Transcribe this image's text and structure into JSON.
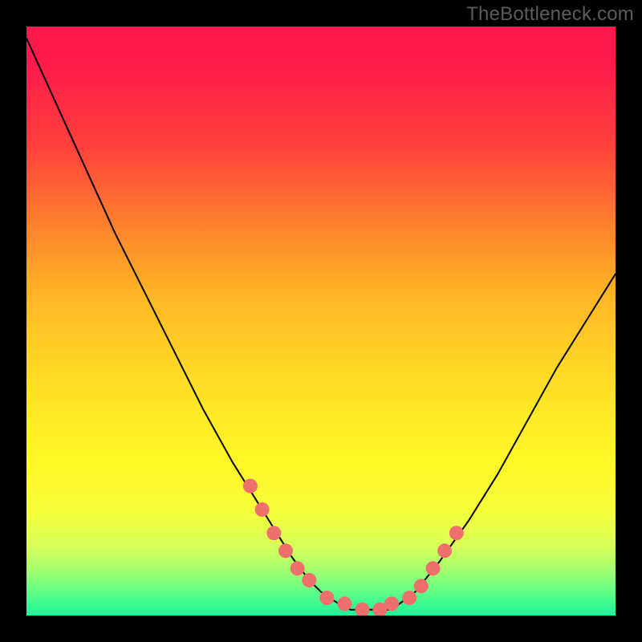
{
  "watermark": "TheBottleneck.com",
  "chart_data": {
    "type": "line",
    "title": "",
    "xlabel": "",
    "ylabel": "",
    "xlim": [
      0,
      100
    ],
    "ylim": [
      0,
      100
    ],
    "grid": false,
    "legend": false,
    "series": [
      {
        "name": "curve",
        "x": [
          0,
          5,
          10,
          15,
          20,
          25,
          30,
          35,
          40,
          45,
          48,
          50,
          53,
          55,
          58,
          62,
          66,
          70,
          75,
          80,
          85,
          90,
          95,
          100
        ],
        "y": [
          98,
          87,
          76,
          65,
          55,
          45,
          35,
          26,
          18,
          10,
          6,
          4,
          2,
          1,
          1,
          1,
          4,
          9,
          16,
          24,
          33,
          42,
          50,
          58
        ]
      },
      {
        "name": "markers",
        "x": [
          38,
          40,
          42,
          44,
          46,
          48,
          51,
          54,
          57,
          60,
          62,
          65,
          67,
          69,
          71,
          73
        ],
        "y": [
          22,
          18,
          14,
          11,
          8,
          6,
          3,
          2,
          1,
          1,
          2,
          3,
          5,
          8,
          11,
          14
        ]
      }
    ],
    "gradient_stops": [
      {
        "pos": 0.0,
        "color": "#ff1a4b"
      },
      {
        "pos": 0.06,
        "color": "#ff1a4b"
      },
      {
        "pos": 0.2,
        "color": "#ff3f3d"
      },
      {
        "pos": 0.33,
        "color": "#ff7e2e"
      },
      {
        "pos": 0.45,
        "color": "#ffb326"
      },
      {
        "pos": 0.56,
        "color": "#ffd226"
      },
      {
        "pos": 0.65,
        "color": "#ffe826"
      },
      {
        "pos": 0.74,
        "color": "#fff726"
      },
      {
        "pos": 0.82,
        "color": "#f7ff3a"
      },
      {
        "pos": 0.88,
        "color": "#d9ff57"
      },
      {
        "pos": 0.92,
        "color": "#a8ff6e"
      },
      {
        "pos": 0.96,
        "color": "#62ff86"
      },
      {
        "pos": 1.0,
        "color": "#17f59a"
      }
    ],
    "marker_color": "#ef6f6d",
    "line_color": "#000000"
  }
}
